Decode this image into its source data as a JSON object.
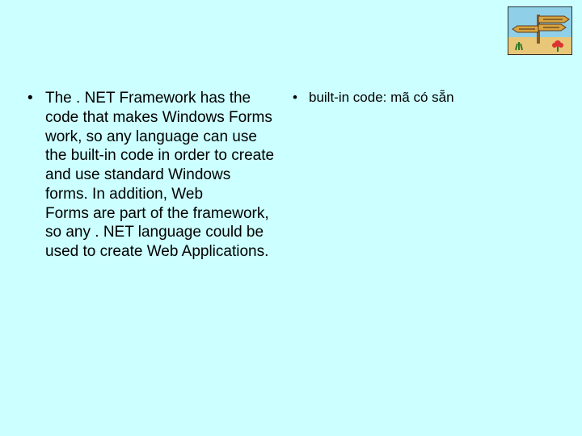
{
  "bullets": {
    "left": "The . NET Framework has the code that makes Windows Forms work, so any language can use the built-in code in order to create and use standard Windows forms. In addition, Web Forms are part of the framework, so any  . NET language could be used to create Web Applications.",
    "right": "built-in code: mã có sẵn"
  },
  "art": {
    "name": "signpost-clipart"
  }
}
